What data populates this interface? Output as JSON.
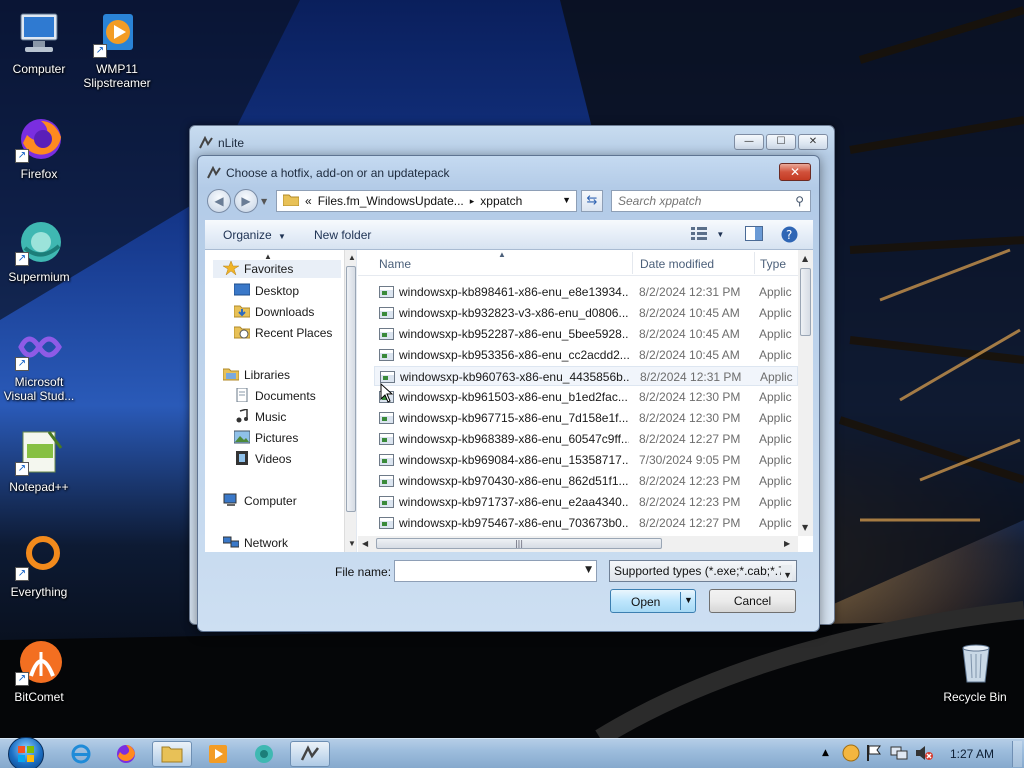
{
  "desktop": {
    "icons": [
      {
        "label": "Computer"
      },
      {
        "label": "WMP11 Slipstreamer"
      },
      {
        "label": "Firefox"
      },
      {
        "label": "Supermium"
      },
      {
        "label": "Microsoft Visual Stud..."
      },
      {
        "label": "Notepad++"
      },
      {
        "label": "Everything"
      },
      {
        "label": "BitComet"
      },
      {
        "label": "Recycle Bin"
      }
    ]
  },
  "main_window": {
    "title": "nLite",
    "caption_buttons": {
      "minimize": "—",
      "maximize": "☐",
      "close": "✕"
    }
  },
  "dialog": {
    "title": "Choose a hotfix, add-on or an updatepack",
    "close_label": "✕",
    "address": {
      "prefix": "«",
      "segment1": "Files.fm_WindowsUpdate...",
      "separator": "▸",
      "segment2": "xppatch"
    },
    "search_placeholder": "Search xppatch",
    "toolbar": {
      "organize": "Organize",
      "new_folder": "New folder"
    },
    "nav_pane": {
      "favorites": "Favorites",
      "desktop": "Desktop",
      "downloads": "Downloads",
      "recent_places": "Recent Places",
      "libraries": "Libraries",
      "documents": "Documents",
      "music": "Music",
      "pictures": "Pictures",
      "videos": "Videos",
      "computer": "Computer",
      "network": "Network"
    },
    "columns": {
      "name": "Name",
      "date_modified": "Date modified",
      "type": "Type"
    },
    "files": [
      {
        "name": "windowsxp-kb898461-x86-enu_e8e13934...",
        "date": "8/2/2024 12:31 PM",
        "type": "Applic"
      },
      {
        "name": "windowsxp-kb932823-v3-x86-enu_d0806...",
        "date": "8/2/2024 10:45 AM",
        "type": "Applic"
      },
      {
        "name": "windowsxp-kb952287-x86-enu_5bee5928...",
        "date": "8/2/2024 10:45 AM",
        "type": "Applic"
      },
      {
        "name": "windowsxp-kb953356-x86-enu_cc2acdd2...",
        "date": "8/2/2024 10:45 AM",
        "type": "Applic"
      },
      {
        "name": "windowsxp-kb960763-x86-enu_4435856b...",
        "date": "8/2/2024 12:31 PM",
        "type": "Applic"
      },
      {
        "name": "windowsxp-kb961503-x86-enu_b1ed2fac...",
        "date": "8/2/2024 12:30 PM",
        "type": "Applic"
      },
      {
        "name": "windowsxp-kb967715-x86-enu_7d158e1f...",
        "date": "8/2/2024 12:30 PM",
        "type": "Applic"
      },
      {
        "name": "windowsxp-kb968389-x86-enu_60547c9ff...",
        "date": "8/2/2024 12:27 PM",
        "type": "Applic"
      },
      {
        "name": "windowsxp-kb969084-x86-enu_15358717...",
        "date": "7/30/2024 9:05 PM",
        "type": "Applic"
      },
      {
        "name": "windowsxp-kb970430-x86-enu_862d51f1...",
        "date": "8/2/2024 12:23 PM",
        "type": "Applic"
      },
      {
        "name": "windowsxp-kb971737-x86-enu_e2aa4340...",
        "date": "8/2/2024 12:23 PM",
        "type": "Applic"
      },
      {
        "name": "windowsxp-kb975467-x86-enu_703673b0...",
        "date": "8/2/2024 12:27 PM",
        "type": "Applic"
      }
    ],
    "filename_label": "File name:",
    "filename_value": "",
    "filetype_value": "Supported types (*.exe;*.cab;*.7",
    "open_label": "Open",
    "cancel_label": "Cancel"
  },
  "taskbar": {
    "clock": "1:27 AM"
  },
  "colors": {
    "accent": "#3c7fb1",
    "title_close": "#c43b23"
  }
}
